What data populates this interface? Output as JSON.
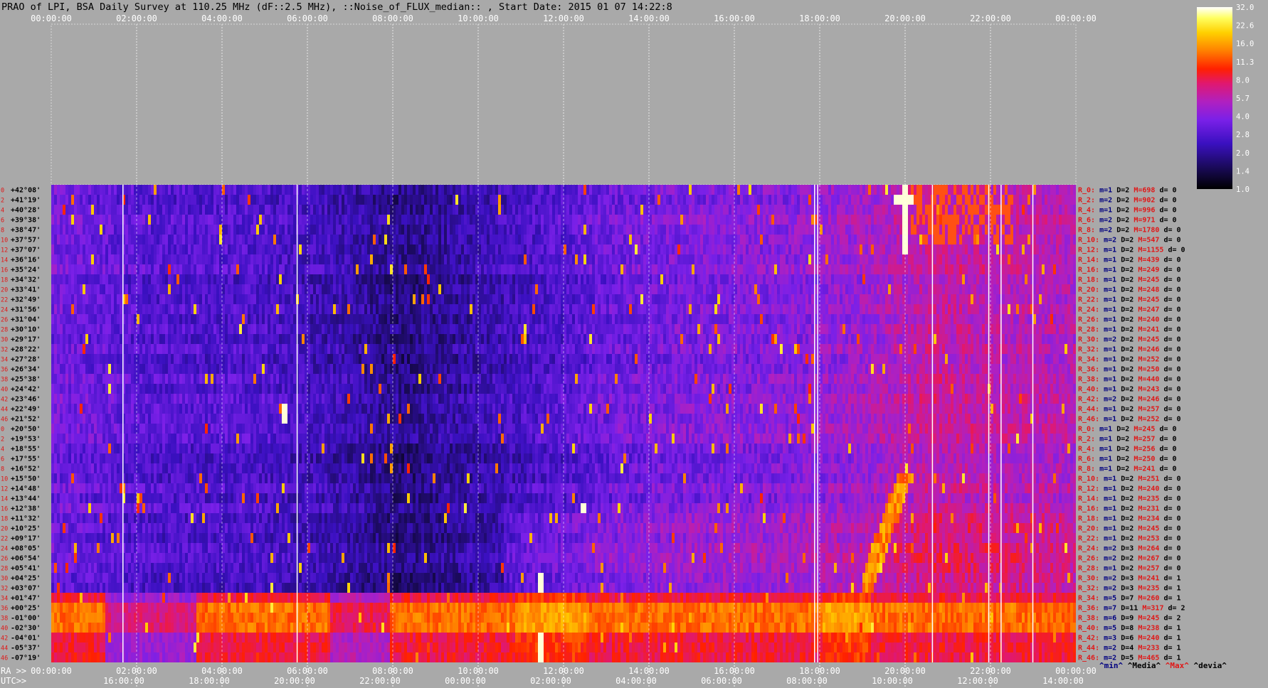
{
  "title": "PRAO of LPI, BSA Daily Survey at 110.25 MHz (dF::2.5 MHz), ::Noise_of_FLUX_median:: , Start Date: 2015 01 07 14:22:8",
  "colors": {
    "background": "#a9a9a9",
    "title_text": "#000000",
    "axis_text": "#ffffff",
    "row_index_text": "#e01818",
    "row_label_text": "#000000",
    "stat_label_red": "#e01818",
    "stat_label_blue": "#000080",
    "grid_line": "#ffffff"
  },
  "chart_data": {
    "type": "heatmap",
    "colormap": "black-blue-purple-red-orange-yellow-white (gnuplot-like)",
    "colorbar": {
      "ticks": [
        "32.0",
        "22.6",
        "16.0",
        "11.3",
        "8.0",
        "5.7",
        "4.0",
        "2.8",
        "2.0",
        "1.4",
        "1.0"
      ],
      "scale": "log",
      "range": [
        1.0,
        32.0
      ]
    },
    "top_axis": {
      "ticks": [
        "00:00:00",
        "02:00:00",
        "04:00:00",
        "06:00:00",
        "08:00:00",
        "10:00:00",
        "12:00:00",
        "14:00:00",
        "16:00:00",
        "18:00:00",
        "20:00:00",
        "22:00:00",
        "00:00:00"
      ]
    },
    "bottom_axes": {
      "ra_label": "RA >>",
      "ra_ticks": [
        "00:00:00",
        "02:00:00",
        "04:00:00",
        "06:00:00",
        "08:00:00",
        "10:00:00",
        "12:00:00",
        "14:00:00",
        "16:00:00",
        "18:00:00",
        "20:00:00",
        "22:00:00",
        "00:00:00"
      ],
      "utc_label": "UTC>>",
      "utc_ticks": [
        "16:00:00",
        "18:00:00",
        "20:00:00",
        "22:00:00",
        "00:00:00",
        "02:00:00",
        "04:00:00",
        "06:00:00",
        "08:00:00",
        "10:00:00",
        "12:00:00",
        "14:00:00"
      ]
    },
    "declinations": [
      "+42°08'",
      "+41°19'",
      "+40°28'",
      "+39°38'",
      "+38°47'",
      "+37°57'",
      "+37°07'",
      "+36°16'",
      "+35°24'",
      "+34°32'",
      "+33°41'",
      "+32°49'",
      "+31°56'",
      "+31°04'",
      "+30°10'",
      "+29°17'",
      "+28°22'",
      "+27°28'",
      "+26°34'",
      "+25°38'",
      "+24°42'",
      "+23°46'",
      "+22°49'",
      "+21°52'",
      "+20°50'",
      "+19°53'",
      "+18°55'",
      "+17°55'",
      "+16°52'",
      "+15°50'",
      "+14°48'",
      "+13°44'",
      "+12°38'",
      "+11°32'",
      "+10°25'",
      "+09°17'",
      "+08°05'",
      "+06°54'",
      "+05°41'",
      "+04°25'",
      "+03°07'",
      "+01°47'",
      "+00°25'",
      "-01°00'",
      "-02°30'",
      "-04°01'",
      "-05°37'",
      "-07°19'"
    ],
    "row_indices": [
      "0",
      "2",
      "4",
      "6",
      "8",
      "10",
      "12",
      "14",
      "16",
      "18",
      "20",
      "22",
      "24",
      "26",
      "28",
      "30",
      "32",
      "34",
      "36",
      "38",
      "40",
      "42",
      "44",
      "46",
      "0",
      "2",
      "4",
      "6",
      "8",
      "10",
      "12",
      "14",
      "16",
      "18",
      "20",
      "22",
      "24",
      "26",
      "28",
      "30",
      "32",
      "34",
      "36",
      "38",
      "40",
      "42",
      "44",
      "46"
    ],
    "row_stats": [
      {
        "r": "R_0:",
        "m": "m=1",
        "d": "D=2",
        "mx": "M=698",
        "dv": "d= 0"
      },
      {
        "r": "R_2:",
        "m": "m=2",
        "d": "D=2",
        "mx": "M=902",
        "dv": "d= 0"
      },
      {
        "r": "R_4:",
        "m": "m=1",
        "d": "D=2",
        "mx": "M=996",
        "dv": "d= 0"
      },
      {
        "r": "R_6:",
        "m": "m=2",
        "d": "D=2",
        "mx": "M=971",
        "dv": "d= 0"
      },
      {
        "r": "R_8:",
        "m": "m=2",
        "d": "D=2",
        "mx": "M=1780",
        "dv": "d= 0"
      },
      {
        "r": "R_10:",
        "m": "m=2",
        "d": "D=2",
        "mx": "M=547",
        "dv": "d= 0"
      },
      {
        "r": "R_12:",
        "m": "m=1",
        "d": "D=2",
        "mx": "M=1155",
        "dv": "d= 0"
      },
      {
        "r": "R_14:",
        "m": "m=1",
        "d": "D=2",
        "mx": "M=439",
        "dv": "d= 0"
      },
      {
        "r": "R_16:",
        "m": "m=1",
        "d": "D=2",
        "mx": "M=249",
        "dv": "d= 0"
      },
      {
        "r": "R_18:",
        "m": "m=1",
        "d": "D=2",
        "mx": "M=245",
        "dv": "d= 0"
      },
      {
        "r": "R_20:",
        "m": "m=1",
        "d": "D=2",
        "mx": "M=248",
        "dv": "d= 0"
      },
      {
        "r": "R_22:",
        "m": "m=1",
        "d": "D=2",
        "mx": "M=245",
        "dv": "d= 0"
      },
      {
        "r": "R_24:",
        "m": "m=1",
        "d": "D=2",
        "mx": "M=247",
        "dv": "d= 0"
      },
      {
        "r": "R_26:",
        "m": "m=1",
        "d": "D=2",
        "mx": "M=240",
        "dv": "d= 0"
      },
      {
        "r": "R_28:",
        "m": "m=1",
        "d": "D=2",
        "mx": "M=241",
        "dv": "d= 0"
      },
      {
        "r": "R_30:",
        "m": "m=2",
        "d": "D=2",
        "mx": "M=245",
        "dv": "d= 0"
      },
      {
        "r": "R_32:",
        "m": "m=1",
        "d": "D=2",
        "mx": "M=246",
        "dv": "d= 0"
      },
      {
        "r": "R_34:",
        "m": "m=1",
        "d": "D=2",
        "mx": "M=252",
        "dv": "d= 0"
      },
      {
        "r": "R_36:",
        "m": "m=1",
        "d": "D=2",
        "mx": "M=250",
        "dv": "d= 0"
      },
      {
        "r": "R_38:",
        "m": "m=1",
        "d": "D=2",
        "mx": "M=440",
        "dv": "d= 0"
      },
      {
        "r": "R_40:",
        "m": "m=1",
        "d": "D=2",
        "mx": "M=243",
        "dv": "d= 0"
      },
      {
        "r": "R_42:",
        "m": "m=2",
        "d": "D=2",
        "mx": "M=246",
        "dv": "d= 0"
      },
      {
        "r": "R_44:",
        "m": "m=1",
        "d": "D=2",
        "mx": "M=257",
        "dv": "d= 0"
      },
      {
        "r": "R_46:",
        "m": "m=1",
        "d": "D=2",
        "mx": "M=252",
        "dv": "d= 0"
      },
      {
        "r": "R_0:",
        "m": "m=1",
        "d": "D=2",
        "mx": "M=245",
        "dv": "d= 0"
      },
      {
        "r": "R_2:",
        "m": "m=1",
        "d": "D=2",
        "mx": "M=257",
        "dv": "d= 0"
      },
      {
        "r": "R_4:",
        "m": "m=1",
        "d": "D=2",
        "mx": "M=256",
        "dv": "d= 0"
      },
      {
        "r": "R_6:",
        "m": "m=1",
        "d": "D=2",
        "mx": "M=250",
        "dv": "d= 0"
      },
      {
        "r": "R_8:",
        "m": "m=1",
        "d": "D=2",
        "mx": "M=241",
        "dv": "d= 0"
      },
      {
        "r": "R_10:",
        "m": "m=1",
        "d": "D=2",
        "mx": "M=251",
        "dv": "d= 0"
      },
      {
        "r": "R_12:",
        "m": "m=1",
        "d": "D=2",
        "mx": "M=240",
        "dv": "d= 0"
      },
      {
        "r": "R_14:",
        "m": "m=1",
        "d": "D=2",
        "mx": "M=235",
        "dv": "d= 0"
      },
      {
        "r": "R_16:",
        "m": "m=1",
        "d": "D=2",
        "mx": "M=231",
        "dv": "d= 0"
      },
      {
        "r": "R_18:",
        "m": "m=1",
        "d": "D=2",
        "mx": "M=234",
        "dv": "d= 0"
      },
      {
        "r": "R_20:",
        "m": "m=1",
        "d": "D=2",
        "mx": "M=245",
        "dv": "d= 0"
      },
      {
        "r": "R_22:",
        "m": "m=1",
        "d": "D=2",
        "mx": "M=253",
        "dv": "d= 0"
      },
      {
        "r": "R_24:",
        "m": "m=2",
        "d": "D=3",
        "mx": "M=264",
        "dv": "d= 0"
      },
      {
        "r": "R_26:",
        "m": "m=2",
        "d": "D=2",
        "mx": "M=267",
        "dv": "d= 0"
      },
      {
        "r": "R_28:",
        "m": "m=1",
        "d": "D=2",
        "mx": "M=257",
        "dv": "d= 0"
      },
      {
        "r": "R_30:",
        "m": "m=2",
        "d": "D=3",
        "mx": "M=241",
        "dv": "d= 1"
      },
      {
        "r": "R_32:",
        "m": "m=2",
        "d": "D=3",
        "mx": "M=235",
        "dv": "d= 1"
      },
      {
        "r": "R_34:",
        "m": "m=5",
        "d": "D=7",
        "mx": "M=260",
        "dv": "d= 1"
      },
      {
        "r": "R_36:",
        "m": "m=7",
        "d": "D=11",
        "mx": "M=317",
        "dv": "d= 2"
      },
      {
        "r": "R_38:",
        "m": "m=6",
        "d": "D=9",
        "mx": "M=245",
        "dv": "d= 2"
      },
      {
        "r": "R_40:",
        "m": "m=5",
        "d": "D=8",
        "mx": "M=238",
        "dv": "d= 1"
      },
      {
        "r": "R_42:",
        "m": "m=3",
        "d": "D=6",
        "mx": "M=240",
        "dv": "d= 1"
      },
      {
        "r": "R_44:",
        "m": "m=2",
        "d": "D=4",
        "mx": "M=233",
        "dv": "d= 1"
      },
      {
        "r": "R_46:",
        "m": "m=2",
        "d": "D=5",
        "mx": "M=465",
        "dv": "d= 1"
      }
    ],
    "stat_legend": {
      "min": "^min^",
      "media": "^Media^",
      "max": "^Max^",
      "devia": "^devia^"
    }
  }
}
